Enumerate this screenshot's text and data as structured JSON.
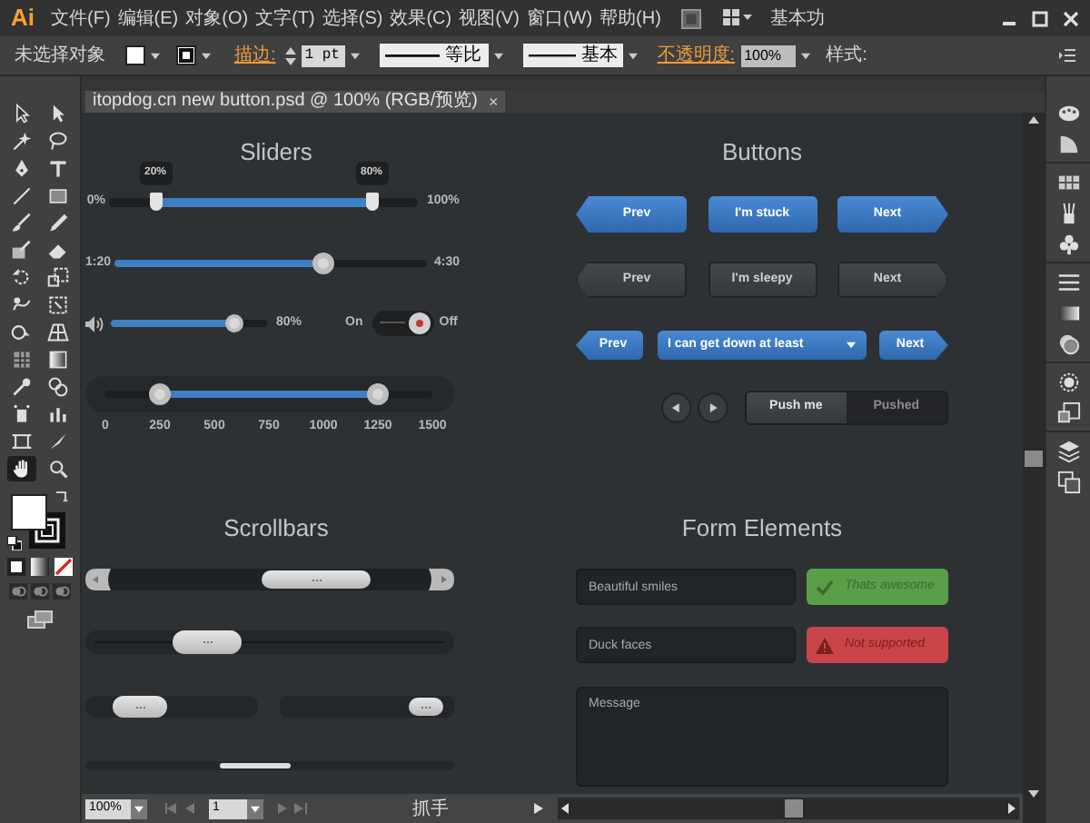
{
  "menu_bar": {
    "logo": "Ai",
    "menus": [
      "文件(F)",
      "编辑(E)",
      "对象(O)",
      "文字(T)",
      "选择(S)",
      "效果(C)",
      "视图(V)",
      "窗口(W)",
      "帮助(H)"
    ],
    "workspace": "基本功"
  },
  "control_bar": {
    "selection": "未选择对象",
    "stroke_label": "描边:",
    "stroke_weight": "1 pt",
    "stroke_profile": "等比",
    "brush": "基本",
    "opacity_label": "不透明度:",
    "opacity": "100%",
    "style_label": "样式:"
  },
  "document_tab": {
    "title": "itopdog.cn new button.psd @ 100% (RGB/预览)",
    "close": "×"
  },
  "toolbox": {
    "tools": [
      {
        "selected": false
      },
      {
        "selected": false
      },
      {
        "selected": false
      },
      {
        "selected": false
      },
      {
        "selected": false
      },
      {
        "selected": false
      },
      {
        "selected": false
      },
      {
        "selected": false
      },
      {
        "selected": false
      },
      {
        "selected": false
      },
      {
        "selected": false
      },
      {
        "selected": false
      },
      {
        "selected": false
      },
      {
        "selected": false
      },
      {
        "selected": false
      },
      {
        "selected": false
      },
      {
        "selected": false
      },
      {
        "selected": false
      },
      {
        "selected": false
      },
      {
        "selected": false
      },
      {
        "selected": false
      },
      {
        "selected": false
      },
      {
        "selected": false
      },
      {
        "selected": false
      },
      {
        "selected": false
      },
      {
        "selected": false
      },
      {
        "selected": true
      },
      {
        "selected": false
      }
    ]
  },
  "sliders": {
    "title": "Sliders",
    "range": {
      "min_label": "0%",
      "max_label": "100%",
      "thumbs": [
        {
          "tooltip": "20%",
          "level": 0.15
        },
        {
          "tooltip": "80%",
          "level": 0.85
        }
      ]
    },
    "seek": {
      "start": "1:20",
      "end": "4:30",
      "level": 0.67
    },
    "volume": {
      "level": 0.79,
      "reading": "80%"
    },
    "toggle": {
      "on_label": "On",
      "off_label": "Off",
      "on": false
    },
    "scale": {
      "thumbs": [
        {
          "level": 0.167
        },
        {
          "level": 0.833
        }
      ],
      "ticks": [
        "0",
        "250",
        "500",
        "750",
        "1000",
        "1250",
        "1500"
      ]
    }
  },
  "buttons": {
    "title": "Buttons",
    "rows": [
      {
        "kind": "primary",
        "buttons": [
          {
            "kind": "prev",
            "label": "Prev"
          },
          {
            "kind": "plain",
            "label": "I'm stuck"
          },
          {
            "kind": "next",
            "label": "Next"
          }
        ]
      },
      {
        "kind": "secondary",
        "buttons": [
          {
            "kind": "prev",
            "label": "Prev"
          },
          {
            "kind": "plain",
            "label": "I'm sleepy"
          },
          {
            "kind": "next",
            "label": "Next"
          }
        ]
      },
      {
        "kind": "primary",
        "buttons": [
          {
            "kind": "prev",
            "label": "Prev"
          },
          {
            "kind": "dropdown",
            "label": "I can get down at least"
          },
          {
            "kind": "next",
            "label": "Next"
          }
        ]
      }
    ],
    "segmented": [
      {
        "label": "Push me",
        "selected": false
      },
      {
        "label": "Pushed",
        "selected": true
      }
    ]
  },
  "scrollbars": {
    "title": "Scrollbars"
  },
  "form": {
    "title": "Form Elements",
    "fields": [
      {
        "value": "Beautiful smiles",
        "status": {
          "kind": "success",
          "text": "Thats awesome"
        }
      },
      {
        "value": "Duck faces",
        "status": {
          "kind": "error",
          "text": "Not supported"
        }
      }
    ],
    "message": {
      "placeholder": "Message"
    }
  },
  "status_bar": {
    "zoom": "100%",
    "page": "1",
    "tool": "抓手"
  }
}
